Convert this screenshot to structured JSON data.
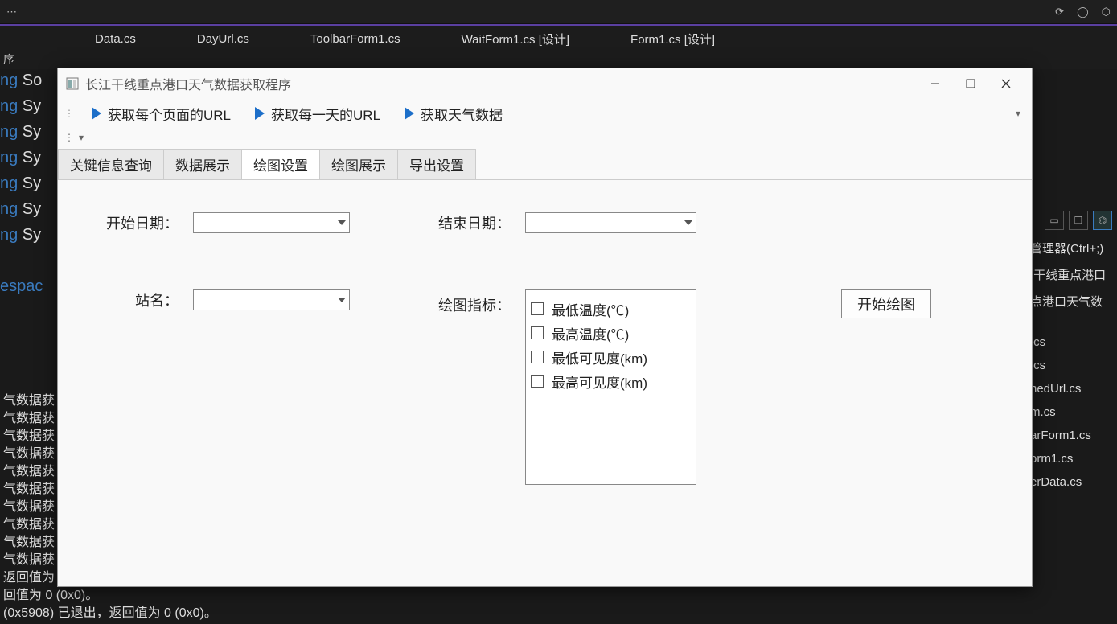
{
  "ide": {
    "tabs": [
      "Data.cs",
      "DayUrl.cs",
      "ToolbarForm1.cs",
      "WaitForm1.cs [设计]",
      "Form1.cs [设计]"
    ],
    "subline": "序",
    "code_lines": [
      {
        "kw": "ng",
        "id": " So"
      },
      {
        "kw": "ng",
        "id": " Sy"
      },
      {
        "kw": "ng",
        "id": " Sy"
      },
      {
        "kw": "ng",
        "id": " Sy"
      },
      {
        "kw": "ng",
        "id": " Sy"
      },
      {
        "kw": "ng",
        "id": " Sy"
      },
      {
        "kw": "ng",
        "id": " Sy"
      },
      {
        "kw": "",
        "id": ""
      },
      {
        "kw": "espac",
        "id": ""
      }
    ],
    "output_lines": [
      "气数据获",
      "气数据获",
      "气数据获",
      "气数据获",
      "气数据获",
      "气数据获",
      "气数据获",
      "气数据获",
      "气数据获",
      "气数据获",
      "返回值为",
      "回值为 0 (0x0)。",
      "(0x5908) 已退出，返回值为 0 (0x0)。"
    ],
    "right": {
      "lines": [
        "管理器(Ctrl+;)",
        "[干线重点港口",
        "点港口天气数",
        ".cs",
        ".cs",
        "nedUrl.cs",
        "m.cs",
        "arForm1.cs",
        "orm1.cs",
        "erData.cs"
      ]
    }
  },
  "dialog": {
    "title": "长江干线重点港口天气数据获取程序",
    "toolbar": {
      "btn1": "获取每个页面的URL",
      "btn2": "获取每一天的URL",
      "btn3": "获取天气数据"
    },
    "tabs": {
      "t1": "关键信息查询",
      "t2": "数据展示",
      "t3": "绘图设置",
      "t4": "绘图展示",
      "t5": "导出设置"
    },
    "form": {
      "start_date_label": "开始日期：",
      "end_date_label": "结束日期：",
      "station_label": "站名：",
      "metric_label": "绘图指标：",
      "metrics": [
        "最低温度(℃)",
        "最高温度(℃)",
        "最低可见度(km)",
        "最高可见度(km)"
      ],
      "submit": "开始绘图"
    }
  }
}
